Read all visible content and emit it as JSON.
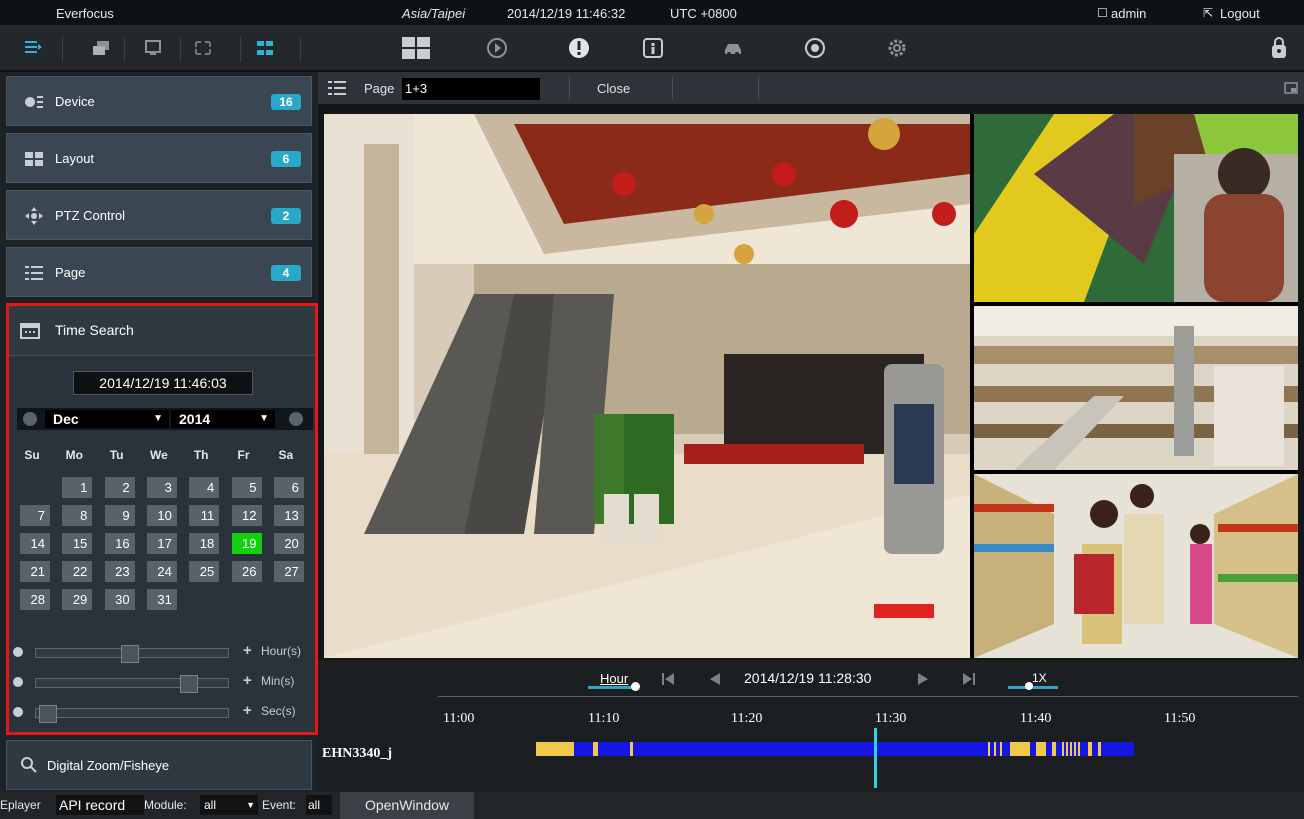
{
  "topbar": {
    "brand": "Everfocus",
    "timezone": "Asia/Taipei",
    "datetime": "2014/12/19 11:46:32",
    "utc": "UTC +0800",
    "user": "admin",
    "logout": "Logout"
  },
  "sidebar": {
    "items": [
      {
        "label": "Device",
        "count": "16",
        "icon": "device-icon"
      },
      {
        "label": "Layout",
        "count": "6",
        "icon": "layout-icon"
      },
      {
        "label": "PTZ Control",
        "count": "2",
        "icon": "ptz-icon"
      },
      {
        "label": "Page",
        "count": "4",
        "icon": "page-icon"
      }
    ],
    "time_search": {
      "title": "Time Search",
      "datetime": "2014/12/19 11:46:03",
      "month": "Dec",
      "year": "2014",
      "weekdays": [
        "Su",
        "Mo",
        "Tu",
        "We",
        "Th",
        "Fr",
        "Sa"
      ],
      "days": [
        "1",
        "2",
        "3",
        "4",
        "5",
        "6",
        "7",
        "8",
        "9",
        "10",
        "11",
        "12",
        "13",
        "14",
        "15",
        "16",
        "17",
        "18",
        "19",
        "20",
        "21",
        "22",
        "23",
        "24",
        "25",
        "26",
        "27",
        "28",
        "29",
        "30",
        "31"
      ],
      "selected_day": "19",
      "first_weekday": 1,
      "sliders": [
        {
          "unit": "Hour(s)",
          "value": 0.49
        },
        {
          "unit": "Min(s)",
          "value": 0.83
        },
        {
          "unit": "Sec(s)",
          "value": 0.02
        }
      ]
    },
    "digital_zoom": "Digital Zoom/Fisheye"
  },
  "pagebar": {
    "label": "Page",
    "value": "1+3",
    "close": "Close"
  },
  "timeline": {
    "zoom_label": "Hour",
    "timestamp": "2014/12/19 11:28:30",
    "speed": "1X",
    "ticks": [
      "11:00",
      "11:10",
      "11:20",
      "11:30",
      "11:40",
      "11:50"
    ],
    "channel": "EHN3340_j"
  },
  "bottombar": {
    "player_label": "Eplayer",
    "record_value": "API record",
    "module_label": "Module:",
    "module_value": "all",
    "event_label": "Event:",
    "event_value": "all",
    "open_window": "OpenWindow"
  },
  "colors": {
    "accent": "#2aa8c8",
    "selected_day": "#12d10f",
    "highlight_border": "#e8161a",
    "record_blue": "#1515e6",
    "record_yellow": "#f0c84a",
    "cursor": "#2ad4e4"
  }
}
